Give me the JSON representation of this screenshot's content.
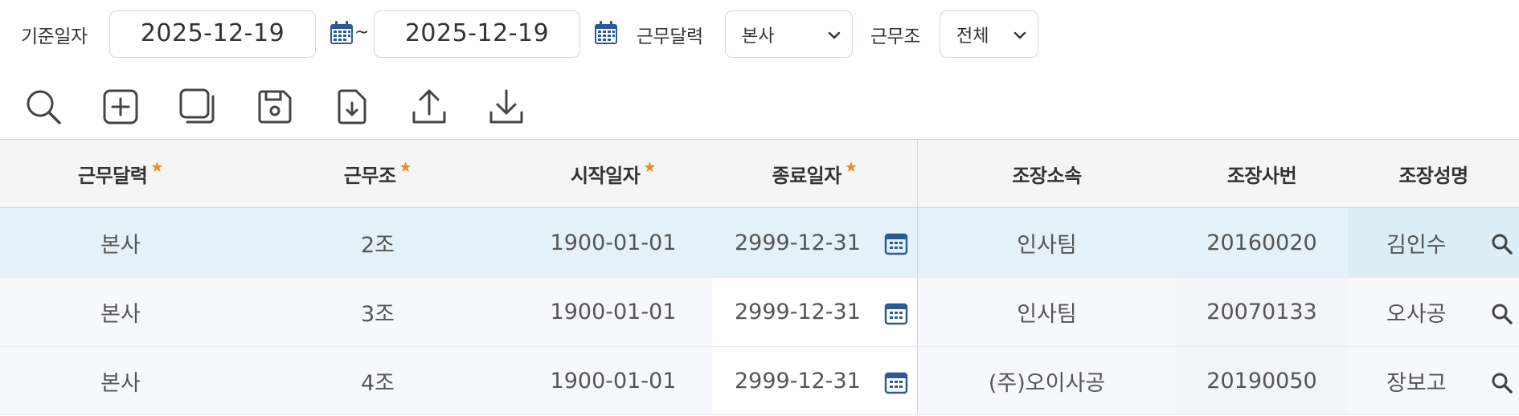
{
  "filters": {
    "date_label": "기준일자",
    "date_from": "2025-12-19",
    "date_to": "2025-12-19",
    "range_separator": "~",
    "calendar_label": "근무달력",
    "calendar_value": "본사",
    "shift_label": "근무조",
    "shift_value": "전체"
  },
  "toolbar": {
    "icons": [
      "search-icon",
      "add-icon",
      "copy-icon",
      "save-icon",
      "file-download-icon",
      "upload-icon",
      "download-icon"
    ]
  },
  "grid": {
    "columns": [
      {
        "label": "근무달력",
        "required": true
      },
      {
        "label": "근무조",
        "required": true
      },
      {
        "label": "시작일자",
        "required": true
      },
      {
        "label": "종료일자",
        "required": true
      },
      {
        "label": "조장소속",
        "required": false
      },
      {
        "label": "조장사번",
        "required": false
      },
      {
        "label": "조장성명",
        "required": false
      }
    ],
    "required_mark": "★",
    "rows": [
      {
        "calendar": "본사",
        "shift": "2조",
        "start": "1900-01-01",
        "end": "2999-12-31",
        "dept": "인사팀",
        "emp_no": "20160020",
        "name": "김인수"
      },
      {
        "calendar": "본사",
        "shift": "3조",
        "start": "1900-01-01",
        "end": "2999-12-31",
        "dept": "인사팀",
        "emp_no": "20070133",
        "name": "오사공"
      },
      {
        "calendar": "본사",
        "shift": "4조",
        "start": "1900-01-01",
        "end": "2999-12-31",
        "dept": "(주)오이사공",
        "emp_no": "20190050",
        "name": "장보고"
      }
    ]
  },
  "colors": {
    "selected_row": "#e4f1f8",
    "required_star": "#f08a1c",
    "calendar_icon": "#2d5a96",
    "input_border": "#cfd8e6"
  }
}
